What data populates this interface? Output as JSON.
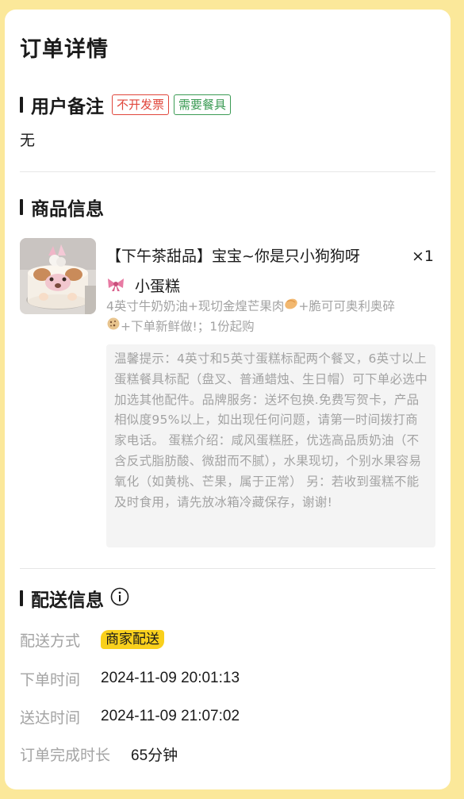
{
  "page": {
    "title": "订单详情"
  },
  "remark_section": {
    "title": "用户备注",
    "tags": [
      "不开发票",
      "需要餐具"
    ],
    "text": "无"
  },
  "product_section": {
    "title": "商品信息",
    "product": {
      "name": "【下午茶甜品】宝宝~你是只小狗狗呀",
      "name_line2": "小蛋糕",
      "quantity": "×1",
      "spec_part1": "4英寸牛奶奶油+现切金煌芒果肉",
      "spec_part2": "+脆可可奥利奥碎",
      "spec_part3": "+下单新鲜做!；1份起购",
      "notice": "温馨提示：4英寸和5英寸蛋糕标配两个餐叉，6英寸以上蛋糕餐具标配（盘叉、普通蜡烛、生日帽）可下单必选中加选其他配件。品牌服务：送坏包换.免费写贺卡，产品相似度95%以上，如出现任何问题，请第一时间拨打商家电话。 蛋糕介绍：咸风蛋糕胚，优选高品质奶油（不含反式脂肪酸、微甜而不腻），水果现切，个别水果容易氧化（如黄桃、芒果，属于正常） 另：若收到蛋糕不能及时食用，请先放冰箱冷藏保存，谢谢!"
    }
  },
  "delivery_section": {
    "title": "配送信息",
    "method_label": "配送方式",
    "method_value": "商家配送",
    "order_time_label": "下单时间",
    "order_time_value": "2024-11-09 20:01:13",
    "arrive_time_label": "送达时间",
    "arrive_time_value": "2024-11-09 21:07:02",
    "duration_label": "订单完成时长",
    "duration_value": "65分钟"
  },
  "colors": {
    "background": "#fbe89a",
    "tag_red": "#e0463b",
    "tag_green": "#3b9b54",
    "badge_yellow": "#f9d01c",
    "muted_text": "#a3a3a3"
  }
}
